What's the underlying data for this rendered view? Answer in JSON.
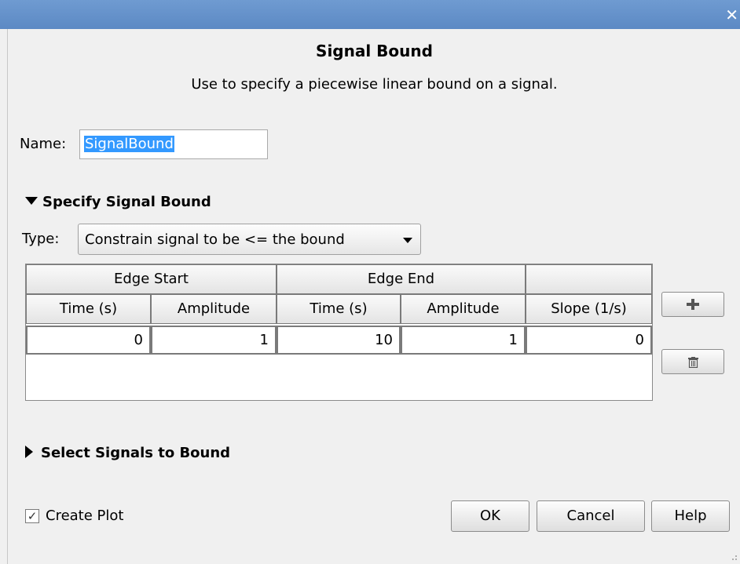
{
  "window": {
    "close_glyph": "✕"
  },
  "dialog": {
    "title": "Signal Bound",
    "description": "Use to specify a piecewise linear bound on a signal."
  },
  "name_field": {
    "label": "Name:",
    "value": "SignalBound"
  },
  "specify_section": {
    "title": "Specify Signal Bound",
    "expanded": true,
    "type_label": "Type:",
    "type_value": "Constrain signal to be <= the bound"
  },
  "table": {
    "groups": [
      "Edge Start",
      "Edge End",
      ""
    ],
    "columns": [
      "Time (s)",
      "Amplitude",
      "Time (s)",
      "Amplitude",
      "Slope (1/s)"
    ],
    "rows": [
      [
        "0",
        "1",
        "10",
        "1",
        "0"
      ]
    ]
  },
  "side_buttons": {
    "add_icon": "plus-icon",
    "delete_icon": "trash-icon"
  },
  "select_section": {
    "title": "Select Signals to Bound",
    "expanded": false
  },
  "footer": {
    "create_plot_label": "Create Plot",
    "create_plot_checked": true,
    "ok_label": "OK",
    "cancel_label": "Cancel",
    "help_label": "Help"
  },
  "colors": {
    "titlebar": "#5c89c4",
    "selection": "#3399ff",
    "background": "#f0f0f0"
  }
}
